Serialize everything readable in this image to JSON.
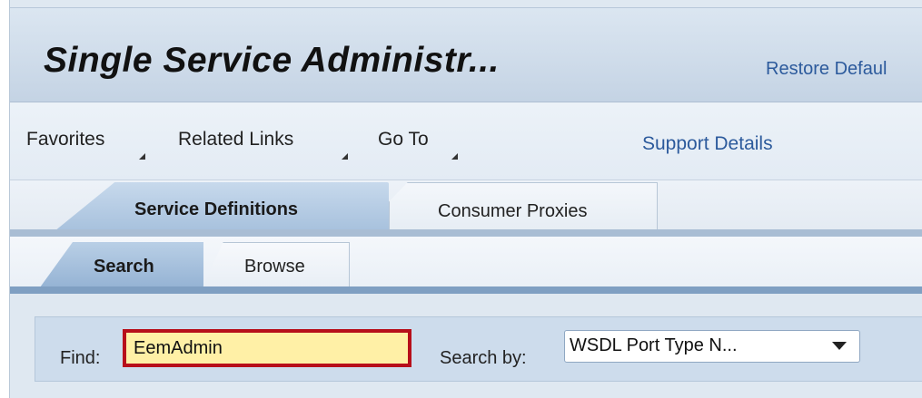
{
  "header": {
    "title": "Single Service Administr...",
    "restore_link": "Restore Defaul"
  },
  "menu": {
    "items": [
      {
        "label": "Favorites"
      },
      {
        "label": "Related Links"
      },
      {
        "label": "Go To"
      }
    ],
    "support_link": "Support Details"
  },
  "tabs": {
    "main": [
      {
        "label": "Service Definitions",
        "selected": true
      },
      {
        "label": "Consumer Proxies",
        "selected": false
      }
    ],
    "sub": [
      {
        "label": "Search",
        "selected": true
      },
      {
        "label": "Browse",
        "selected": false
      }
    ]
  },
  "search": {
    "find_label": "Find:",
    "find_value": "EemAdmin",
    "search_by_label": "Search by:",
    "search_by_value": "WSDL Port Type N..."
  },
  "icons": {
    "menu_dropdown": "dropdown-corner-icon",
    "select_dropdown": "chevron-down-icon"
  },
  "colors": {
    "link": "#2c5a9c",
    "active_tab": "#a7c1dd",
    "highlight_border": "#b70f1a",
    "highlight_fill": "#fff0a6"
  }
}
